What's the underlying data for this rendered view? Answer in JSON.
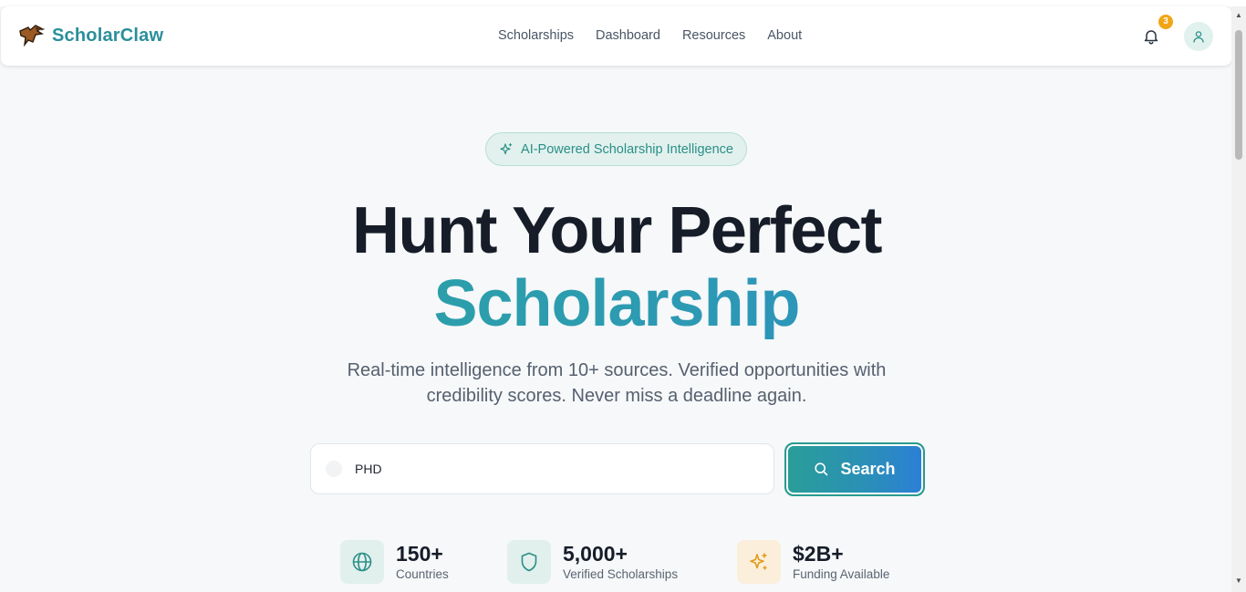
{
  "brand": {
    "name": "ScholarClaw",
    "logo_icon": "eagle-logo-icon"
  },
  "nav": {
    "links": [
      {
        "label": "Scholarships"
      },
      {
        "label": "Dashboard"
      },
      {
        "label": "Resources"
      },
      {
        "label": "About"
      }
    ]
  },
  "header": {
    "notifications_count": "3",
    "bell_icon": "bell-icon",
    "avatar_icon": "user-icon"
  },
  "hero": {
    "badge": "AI-Powered Scholarship Intelligence",
    "title_line1": "Hunt Your Perfect",
    "title_line2": "Scholarship",
    "subtitle": "Real-time intelligence from 10+ sources. Verified opportunities with credibility scores. Never miss a deadline again."
  },
  "search": {
    "value": "PHD",
    "button_label": "Search"
  },
  "stats": [
    {
      "value": "150+",
      "label": "Countries",
      "icon": "globe-icon",
      "color": "#2a8f86"
    },
    {
      "value": "5,000+",
      "label": "Verified Scholarships",
      "icon": "shield-icon",
      "color": "#2a8f86"
    },
    {
      "value": "$2B+",
      "label": "Funding Available",
      "icon": "sparkles-icon",
      "color": "#e39a1a"
    }
  ],
  "colors": {
    "accent": "#2a8f9a",
    "gradient_start": "#2aa69a",
    "gradient_end": "#2b84cf",
    "badge_bg": "#f2a516"
  }
}
